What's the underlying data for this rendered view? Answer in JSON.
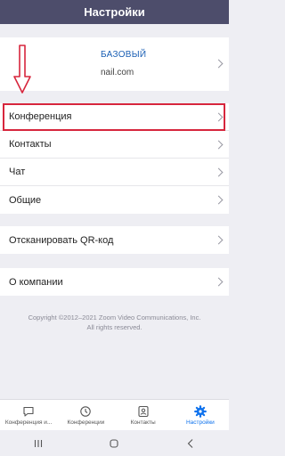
{
  "header": {
    "title": "Настройки"
  },
  "profile": {
    "plan": "БАЗОВЫЙ",
    "email_partial": "nail.com"
  },
  "menu_group_1": [
    {
      "label": "Конференция"
    },
    {
      "label": "Контакты"
    },
    {
      "label": "Чат"
    },
    {
      "label": "Общие"
    }
  ],
  "menu_group_2": [
    {
      "label": "Отсканировать QR-код"
    }
  ],
  "menu_group_3": [
    {
      "label": "О компании"
    }
  ],
  "copyright": {
    "line1": "Copyright ©2012–2021 Zoom Video Communications, Inc.",
    "line2": "All rights reserved."
  },
  "tabs": [
    {
      "label": "Конференция и...",
      "icon": "chat-bubble-icon",
      "active": false
    },
    {
      "label": "Конференции",
      "icon": "clock-icon",
      "active": false
    },
    {
      "label": "Контакты",
      "icon": "contact-card-icon",
      "active": false
    },
    {
      "label": "Настройки",
      "icon": "gear-icon",
      "active": true
    }
  ],
  "colors": {
    "header": "#4d4d6b",
    "accent": "#0e72ed",
    "annotation": "#d7263d"
  }
}
